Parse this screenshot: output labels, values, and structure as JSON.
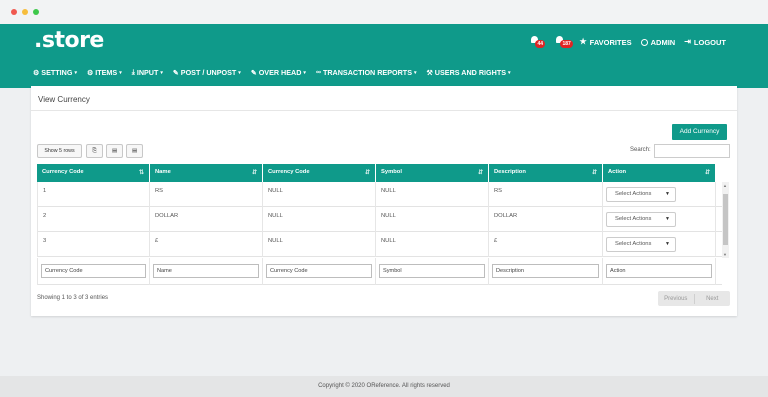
{
  "brand": {
    "logo": ".store"
  },
  "topbar": {
    "notifications": [
      {
        "icon": "bell-icon",
        "count": "44"
      },
      {
        "icon": "bell-icon",
        "count": "187"
      }
    ],
    "favorites_label": "FAVORITES",
    "admin_label": "ADMIN",
    "logout_label": "LOGOUT"
  },
  "nav": {
    "items": [
      {
        "icon": "gear-icon",
        "label": "SETTING"
      },
      {
        "icon": "gear-icon",
        "label": "ITEMS"
      },
      {
        "icon": "download-icon",
        "label": "INPUT"
      },
      {
        "icon": "edit-icon",
        "label": "POST / UNPOST"
      },
      {
        "icon": "edit-icon",
        "label": "OVER HEAD"
      },
      {
        "icon": "link-icon",
        "label": "TRANSACTION REPORTS"
      },
      {
        "icon": "wrench-icon",
        "label": "USERS AND RIGHTS"
      }
    ]
  },
  "page": {
    "title": "View Currency",
    "add_button": "Add Currency",
    "show_rows": "Show 5 rows",
    "search_label": "Search:",
    "search_value": ""
  },
  "table": {
    "columns": [
      "Currency Code",
      "Name",
      "Currency Code",
      "Symbol",
      "Description",
      "Action"
    ],
    "rows": [
      [
        "1",
        "RS",
        "NULL",
        "NULL",
        "RS"
      ],
      [
        "2",
        "DOLLAR",
        "NULL",
        "NULL",
        "DOLLAR"
      ],
      [
        "3",
        "£",
        "NULL",
        "NULL",
        "£"
      ]
    ],
    "action_select": "Select Actions",
    "filters": [
      "Currency Code",
      "Name",
      "Currency Code",
      "Symbol",
      "Description",
      "Action"
    ],
    "info": "Showing 1 to 3 of 3 entries",
    "prev_label": "Previous",
    "next_label": "Next"
  },
  "footer": {
    "text": "Copyright © 2020 OReference. All rights reserved"
  },
  "colors": {
    "brand": "#0f9a8a",
    "badge": "#e02424"
  }
}
